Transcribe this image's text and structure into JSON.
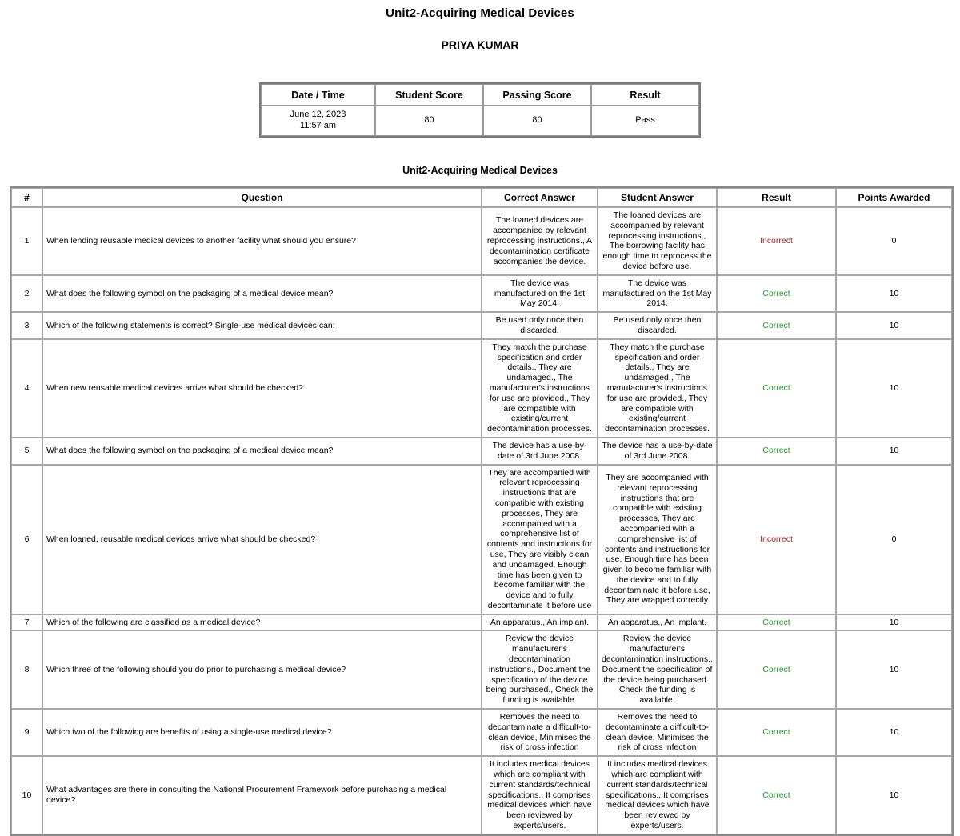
{
  "document": {
    "title": "Unit2-Acquiring Medical Devices",
    "student_name": "PRIYA KUMAR",
    "section_title": "Unit2-Acquiring Medical Devices"
  },
  "summary": {
    "headers": [
      "Date / Time",
      "Student Score",
      "Passing Score",
      "Result"
    ],
    "date": "June 12, 2023",
    "time": "11:57 am",
    "student_score": "80",
    "passing_score": "80",
    "result": "Pass"
  },
  "results_table": {
    "headers": [
      "#",
      "Question",
      "Correct Answer",
      "Student Answer",
      "Result",
      "Points Awarded"
    ],
    "colors": {
      "correct": "#1d9e26",
      "incorrect": "#b02020"
    },
    "rows": [
      {
        "num": "1",
        "question": "When lending reusable medical devices to another facility what should you ensure?",
        "correct_answer": "The loaned devices are accompanied by relevant reprocessing instructions., A decontamination certificate accompanies the device.",
        "student_answer": "The loaned devices are accompanied by relevant reprocessing instructions., The borrowing facility has enough time to reprocess the device before use.",
        "result": "Incorrect",
        "points": "0"
      },
      {
        "num": "2",
        "question": "What does the following symbol on the packaging of a medical device mean?",
        "correct_answer": "The device was manufactured on the 1st May 2014.",
        "student_answer": "The device was manufactured on the 1st May 2014.",
        "result": "Correct",
        "points": "10"
      },
      {
        "num": "3",
        "question": "Which of the following statements is correct? Single-use medical devices can:",
        "correct_answer": "Be used only once then discarded.",
        "student_answer": "Be used only once then discarded.",
        "result": "Correct",
        "points": "10"
      },
      {
        "num": "4",
        "question": "When new reusable medical devices arrive what should be checked?",
        "correct_answer": "They match the purchase specification and order details., They are undamaged., The manufacturer's instructions for use are provided., They are compatible with existing/current decontamination processes.",
        "student_answer": "They match the purchase specification and order details., They are undamaged., The manufacturer's instructions for use are provided., They are compatible with existing/current decontamination processes.",
        "result": "Correct",
        "points": "10"
      },
      {
        "num": "5",
        "question": "What does the following symbol on the packaging of a medical device mean?",
        "correct_answer": "The device has a use-by-date of 3rd June 2008.",
        "student_answer": "The device has a use-by-date of 3rd June 2008.",
        "result": "Correct",
        "points": "10"
      },
      {
        "num": "6",
        "question": "When loaned, reusable medical devices arrive what should be checked?",
        "correct_answer": "They are accompanied with relevant reprocessing instructions that are compatible with existing processes, They are accompanied with a comprehensive list of contents and instructions for use, They are visibly clean and undamaged, Enough time has been given to become familiar with the device and to fully decontaminate it before use",
        "student_answer": "They are accompanied with relevant reprocessing instructions that are compatible with existing processes, They are accompanied with a comprehensive list of contents and instructions for use, Enough time has been given to become familiar with the device and to fully decontaminate it before use, They are wrapped correctly",
        "result": "Incorrect",
        "points": "0"
      },
      {
        "num": "7",
        "question": "Which of the following are classified as a medical device?",
        "correct_answer": "An apparatus., An implant.",
        "student_answer": "An apparatus., An implant.",
        "result": "Correct",
        "points": "10"
      },
      {
        "num": "8",
        "question": "Which three of the following should you do prior to purchasing a medical device?",
        "correct_answer": "Review the device manufacturer's decontamination instructions., Document the specification of the device being purchased., Check the funding is available.",
        "student_answer": "Review the device manufacturer's decontamination instructions., Document the specification of the device being purchased., Check the funding is available.",
        "result": "Correct",
        "points": "10"
      },
      {
        "num": "9",
        "question": "Which two of the following are benefits of using a single-use medical device?",
        "correct_answer": "Removes the need to decontaminate a difficult-to-clean device, Minimises the risk of cross infection",
        "student_answer": "Removes the need to decontaminate a difficult-to-clean device, Minimises the risk of cross infection",
        "result": "Correct",
        "points": "10"
      },
      {
        "num": "10",
        "question": "What advantages are there in consulting the National Procurement Framework before purchasing a medical device?",
        "correct_answer": "It includes medical devices which are compliant with current standards/technical specifications., It comprises medical devices which have been reviewed by experts/users.",
        "student_answer": "It includes medical devices which are compliant with current standards/technical specifications., It comprises medical devices which have been reviewed by experts/users.",
        "result": "Correct",
        "points": "10"
      }
    ]
  }
}
